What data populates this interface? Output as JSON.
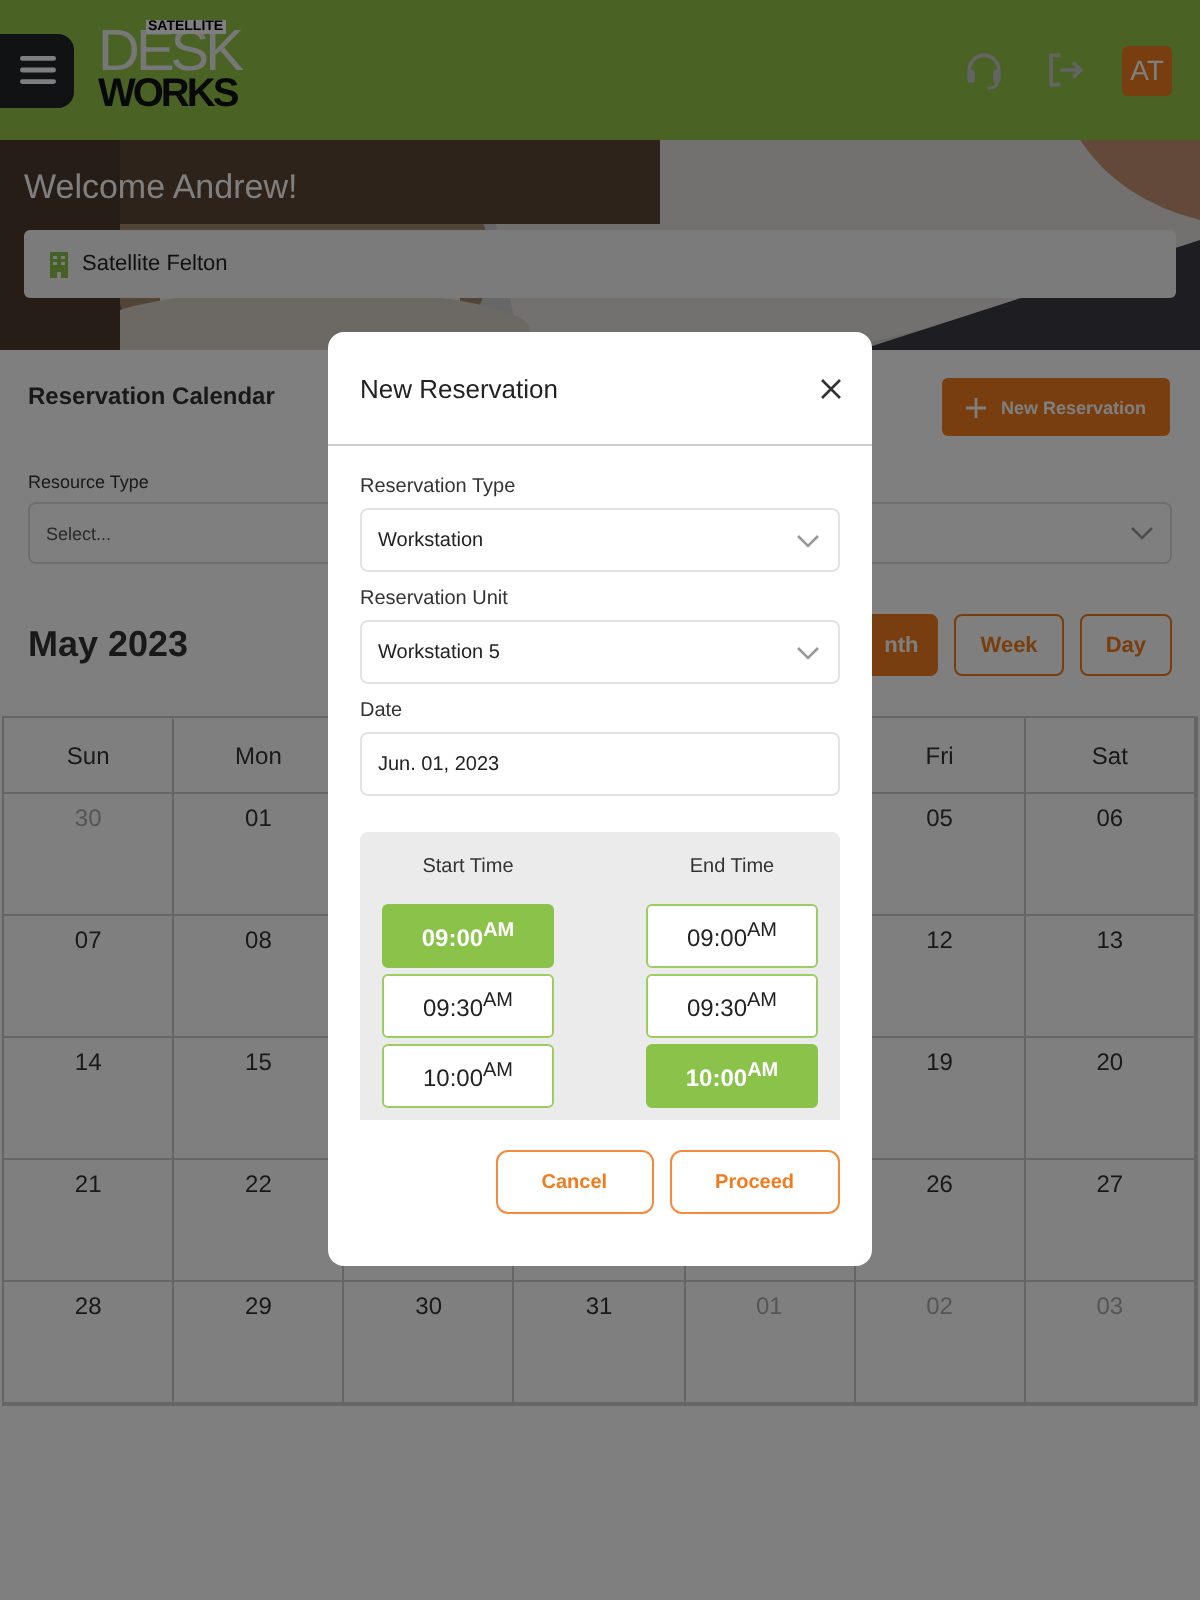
{
  "header": {
    "logo": {
      "small": "SATELLITE",
      "top": "DESK",
      "bottom": "WORKS"
    },
    "avatar": "AT"
  },
  "hero": {
    "greeting": "Welcome Andrew!",
    "location": "Satellite Felton"
  },
  "calendar_panel": {
    "title": "Reservation Calendar",
    "new_button": "New Reservation",
    "filters": [
      {
        "label": "Resource Type",
        "placeholder": "Select...",
        "kind": "field"
      },
      {
        "kind": "select"
      }
    ],
    "month_label": "May 2023",
    "views": [
      {
        "label": "nth",
        "selected": true
      },
      {
        "label": "Week",
        "selected": false
      },
      {
        "label": "Day",
        "selected": false
      }
    ]
  },
  "calendar": {
    "weekdays": [
      "Sun",
      "Mon",
      "Fri",
      "Sat"
    ],
    "weeks": [
      [
        {
          "day": "30",
          "muted": true
        },
        {
          "day": "01",
          "muted": false
        },
        {
          "day": "05",
          "muted": false
        },
        {
          "day": "06",
          "muted": false
        }
      ],
      [
        {
          "day": "07",
          "muted": false
        },
        {
          "day": "08",
          "muted": false
        },
        {
          "day": "12",
          "muted": false
        },
        {
          "day": "13",
          "muted": false
        }
      ],
      [
        {
          "day": "14",
          "muted": false
        },
        {
          "day": "15",
          "muted": false
        },
        {
          "day": "19",
          "muted": false
        },
        {
          "day": "20",
          "muted": false
        }
      ],
      [
        {
          "day": "21",
          "muted": false
        },
        {
          "day": "22",
          "muted": false
        },
        {
          "day": "26",
          "muted": false
        },
        {
          "day": "27",
          "muted": false
        }
      ],
      [
        {
          "day": "28",
          "muted": false
        },
        {
          "day": "29",
          "muted": false
        },
        {
          "day": "30",
          "muted": false
        },
        {
          "day": "31",
          "muted": false
        },
        {
          "day": "01",
          "muted": true
        },
        {
          "day": "02",
          "muted": true
        },
        {
          "day": "03",
          "muted": true
        }
      ]
    ]
  },
  "modal": {
    "title": "New Reservation",
    "fields": [
      {
        "label": "Reservation Type",
        "value": "Workstation",
        "kind": "select"
      },
      {
        "label": "Reservation Unit",
        "value": "Workstation 5",
        "kind": "select"
      },
      {
        "label": "Date",
        "value": "Jun. 01, 2023",
        "kind": "text"
      }
    ],
    "times": [
      {
        "heading": "Start Time",
        "slots": [
          {
            "time": "09:00$^{AM}$",
            "selected": true
          },
          {
            "time": "09:30$^{AM}$",
            "selected": false
          },
          {
            "time": "10:00$^{AM}$",
            "selected": false
          }
        ]
      },
      {
        "heading": "End Time",
        "slots": [
          {
            "time": "09:00$^{AM}$",
            "selected": false
          },
          {
            "time": "09:30$^{AM}$",
            "selected": false
          },
          {
            "time": "10:00$^{AM}$",
            "selected": true
          }
        ]
      }
    ],
    "buttons": [
      "Cancel",
      "Proceed"
    ]
  }
}
